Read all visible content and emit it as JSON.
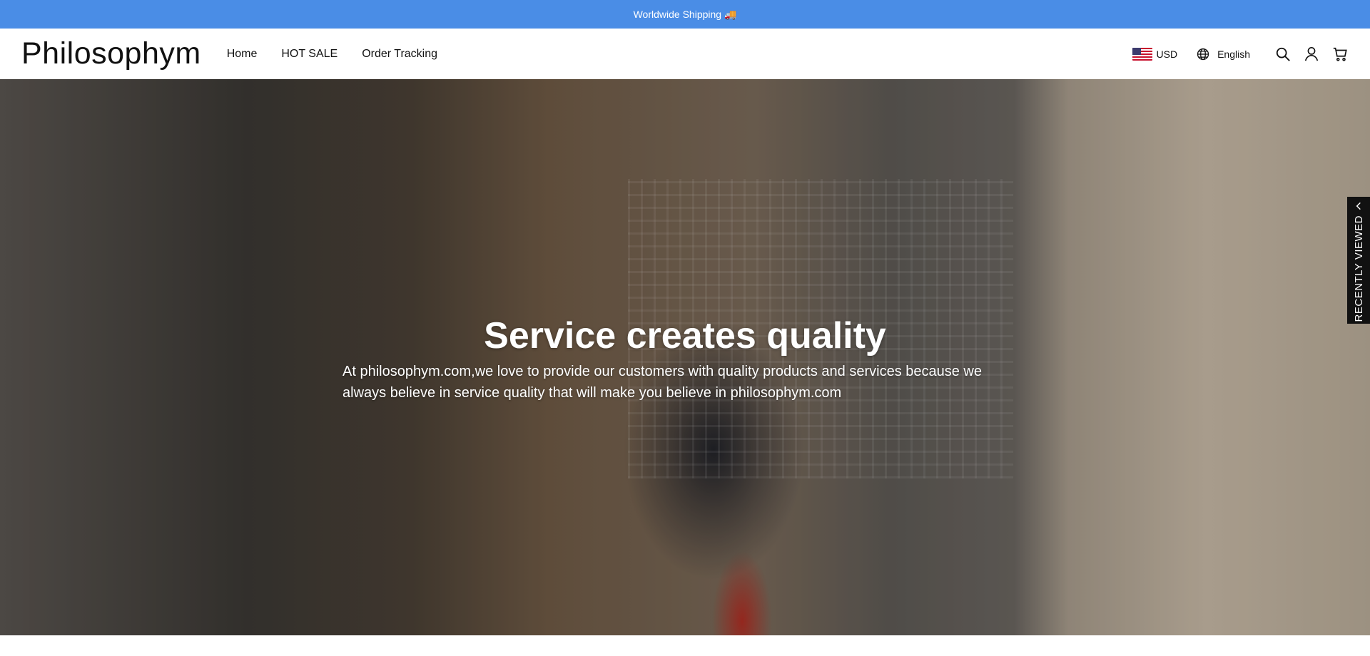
{
  "announcement": {
    "text": "Worldwide Shipping 🚚"
  },
  "header": {
    "logo": "Philosophym",
    "nav": [
      {
        "label": "Home"
      },
      {
        "label": "HOT SALE"
      },
      {
        "label": "Order Tracking"
      }
    ],
    "currency": "USD",
    "language": "English",
    "icons": [
      "us-flag-icon",
      "globe-icon",
      "search-icon",
      "user-icon",
      "cart-icon"
    ]
  },
  "hero": {
    "title": "Service creates quality",
    "text": "At philosophym.com,we love to provide our customers with quality products and services because we always believe in service quality that will make you believe in philosophym.com"
  },
  "side_tab": {
    "label": "RECENTLY VIEWED"
  },
  "colors": {
    "announcement_bg": "#4a8de6",
    "side_tab_bg": "#111111"
  }
}
